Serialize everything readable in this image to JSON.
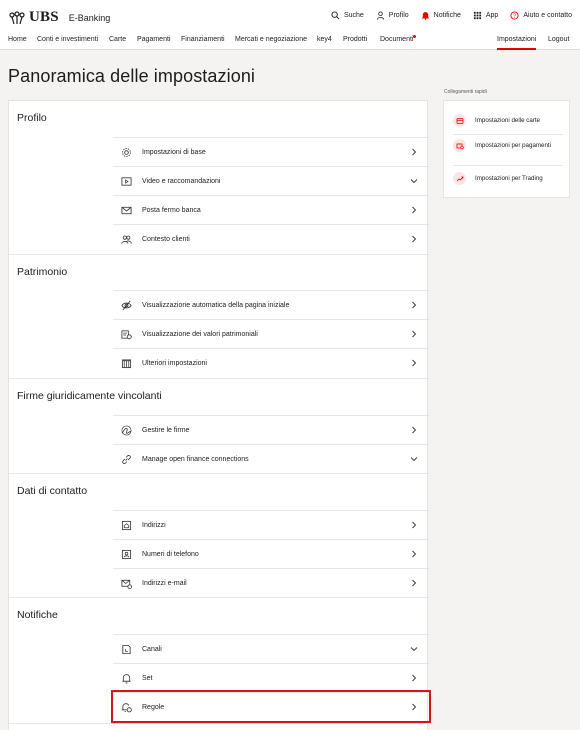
{
  "header": {
    "logo": "UBS",
    "app_name": "E-Banking",
    "top_links": [
      {
        "label": "Suche",
        "icon": "search-icon"
      },
      {
        "label": "Profilo",
        "icon": "person-icon"
      },
      {
        "label": "Notifiche",
        "icon": "bell-icon"
      },
      {
        "label": "App",
        "icon": "grid-icon"
      },
      {
        "label": "Aiuto e contatto",
        "icon": "help-icon"
      }
    ],
    "nav": [
      "Home",
      "Conti e investimenti",
      "Carte",
      "Pagamenti",
      "Finanziamenti",
      "Mercati e negoziazione",
      "key4",
      "Prodotti",
      "Documenti"
    ],
    "nav_right": [
      "Impostazioni",
      "Logout"
    ],
    "accent_color": "#e60000"
  },
  "page_title": "Panoramica delle impostazioni",
  "sections": [
    {
      "title": "Profilo",
      "rows": [
        {
          "label": "Impostazioni di base",
          "icon": "settings-icon",
          "chevron": "right"
        },
        {
          "label": "Video e raccomandazioni",
          "icon": "video-icon",
          "chevron": "down"
        },
        {
          "label": "Posta fermo banca",
          "icon": "mail-icon",
          "chevron": "right"
        },
        {
          "label": "Contesto clienti",
          "icon": "people-icon",
          "chevron": "right"
        }
      ]
    },
    {
      "title": "Patrimonio",
      "rows": [
        {
          "label": "Visualizzazione automatica della pagina iniziale",
          "icon": "eye-off-icon",
          "chevron": "right"
        },
        {
          "label": "Visualizzazione dei valori patrimoniali",
          "icon": "wealth-icon",
          "chevron": "right"
        },
        {
          "label": "Ulteriori impostazioni",
          "icon": "building-icon",
          "chevron": "right"
        }
      ]
    },
    {
      "title": "Firme giuridicamente vincolanti",
      "rows": [
        {
          "label": "Gestire le firme",
          "icon": "signature-icon",
          "chevron": "right"
        },
        {
          "label": "Manage open finance connections",
          "icon": "link-icon",
          "chevron": "down"
        }
      ]
    },
    {
      "title": "Dati di contatto",
      "rows": [
        {
          "label": "Indirizzi",
          "icon": "address-icon",
          "chevron": "right"
        },
        {
          "label": "Numeri di telefono",
          "icon": "phone-contact-icon",
          "chevron": "right"
        },
        {
          "label": "Indirizzi e-mail",
          "icon": "email-settings-icon",
          "chevron": "right"
        }
      ]
    },
    {
      "title": "Notifiche",
      "rows": [
        {
          "label": "Canali",
          "icon": "channel-icon",
          "chevron": "down"
        },
        {
          "label": "Set",
          "icon": "bell-outline-icon",
          "chevron": "right"
        },
        {
          "label": "Regole",
          "icon": "bell-rule-icon",
          "chevron": "right",
          "highlighted": true
        }
      ]
    }
  ],
  "quick_links": {
    "title": "Collegamenti rapidi",
    "items": [
      {
        "label": "Impostazioni delle carte",
        "icon": "card-icon"
      },
      {
        "label": "Impostazioni per pagamenti",
        "icon": "payment-icon"
      },
      {
        "label": "Impostazioni per Trading",
        "icon": "trend-icon"
      }
    ]
  }
}
